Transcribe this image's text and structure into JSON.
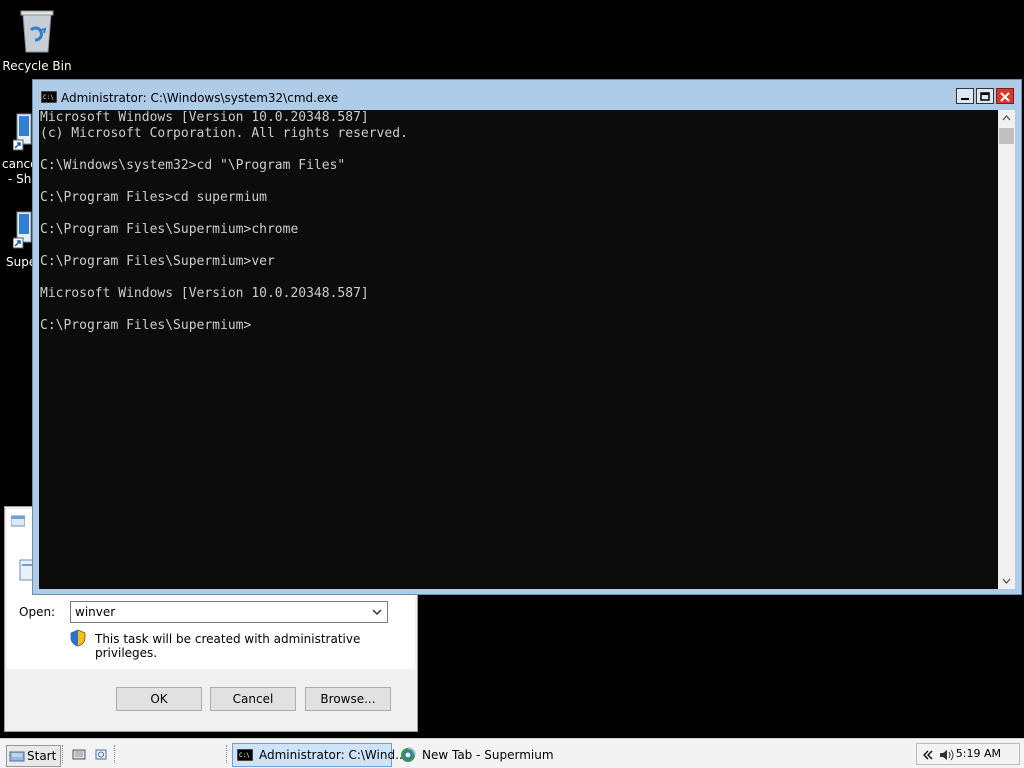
{
  "desktop": {
    "icons": [
      {
        "label": "Recycle Bin",
        "icon": "recycle-bin-icon"
      },
      {
        "label": "cance",
        "icon": "shortcut-icon",
        "label2": "- Sh"
      },
      {
        "label": "Supe",
        "icon": "shortcut-icon"
      }
    ]
  },
  "run_dialog": {
    "open_label": "Open:",
    "open_value": "winver",
    "admin_note": "This task will be created with administrative privileges.",
    "ok_label": "OK",
    "cancel_label": "Cancel",
    "browse_label": "Browse..."
  },
  "cmd_window": {
    "title": "Administrator: C:\\Windows\\system32\\cmd.exe",
    "output": "Microsoft Windows [Version 10.0.20348.587]\n(c) Microsoft Corporation. All rights reserved.\n\nC:\\Windows\\system32>cd \"\\Program Files\"\n\nC:\\Program Files>cd supermium\n\nC:\\Program Files\\Supermium>chrome\n\nC:\\Program Files\\Supermium>ver\n\nMicrosoft Windows [Version 10.0.20348.587]\n\nC:\\Program Files\\Supermium>"
  },
  "taskbar": {
    "start_label": "Start",
    "tasks": [
      {
        "label": "Administrator: C:\\Wind...",
        "icon": "cmd-icon",
        "active": true
      },
      {
        "label": "New Tab - Supermium",
        "icon": "browser-icon",
        "active": false
      }
    ],
    "clock": "5:19 AM"
  },
  "colors": {
    "console_bg": "#0c0c0c",
    "console_text": "#cccccc",
    "window_frame": "#aecbe8",
    "close_button": "#d9382d"
  }
}
